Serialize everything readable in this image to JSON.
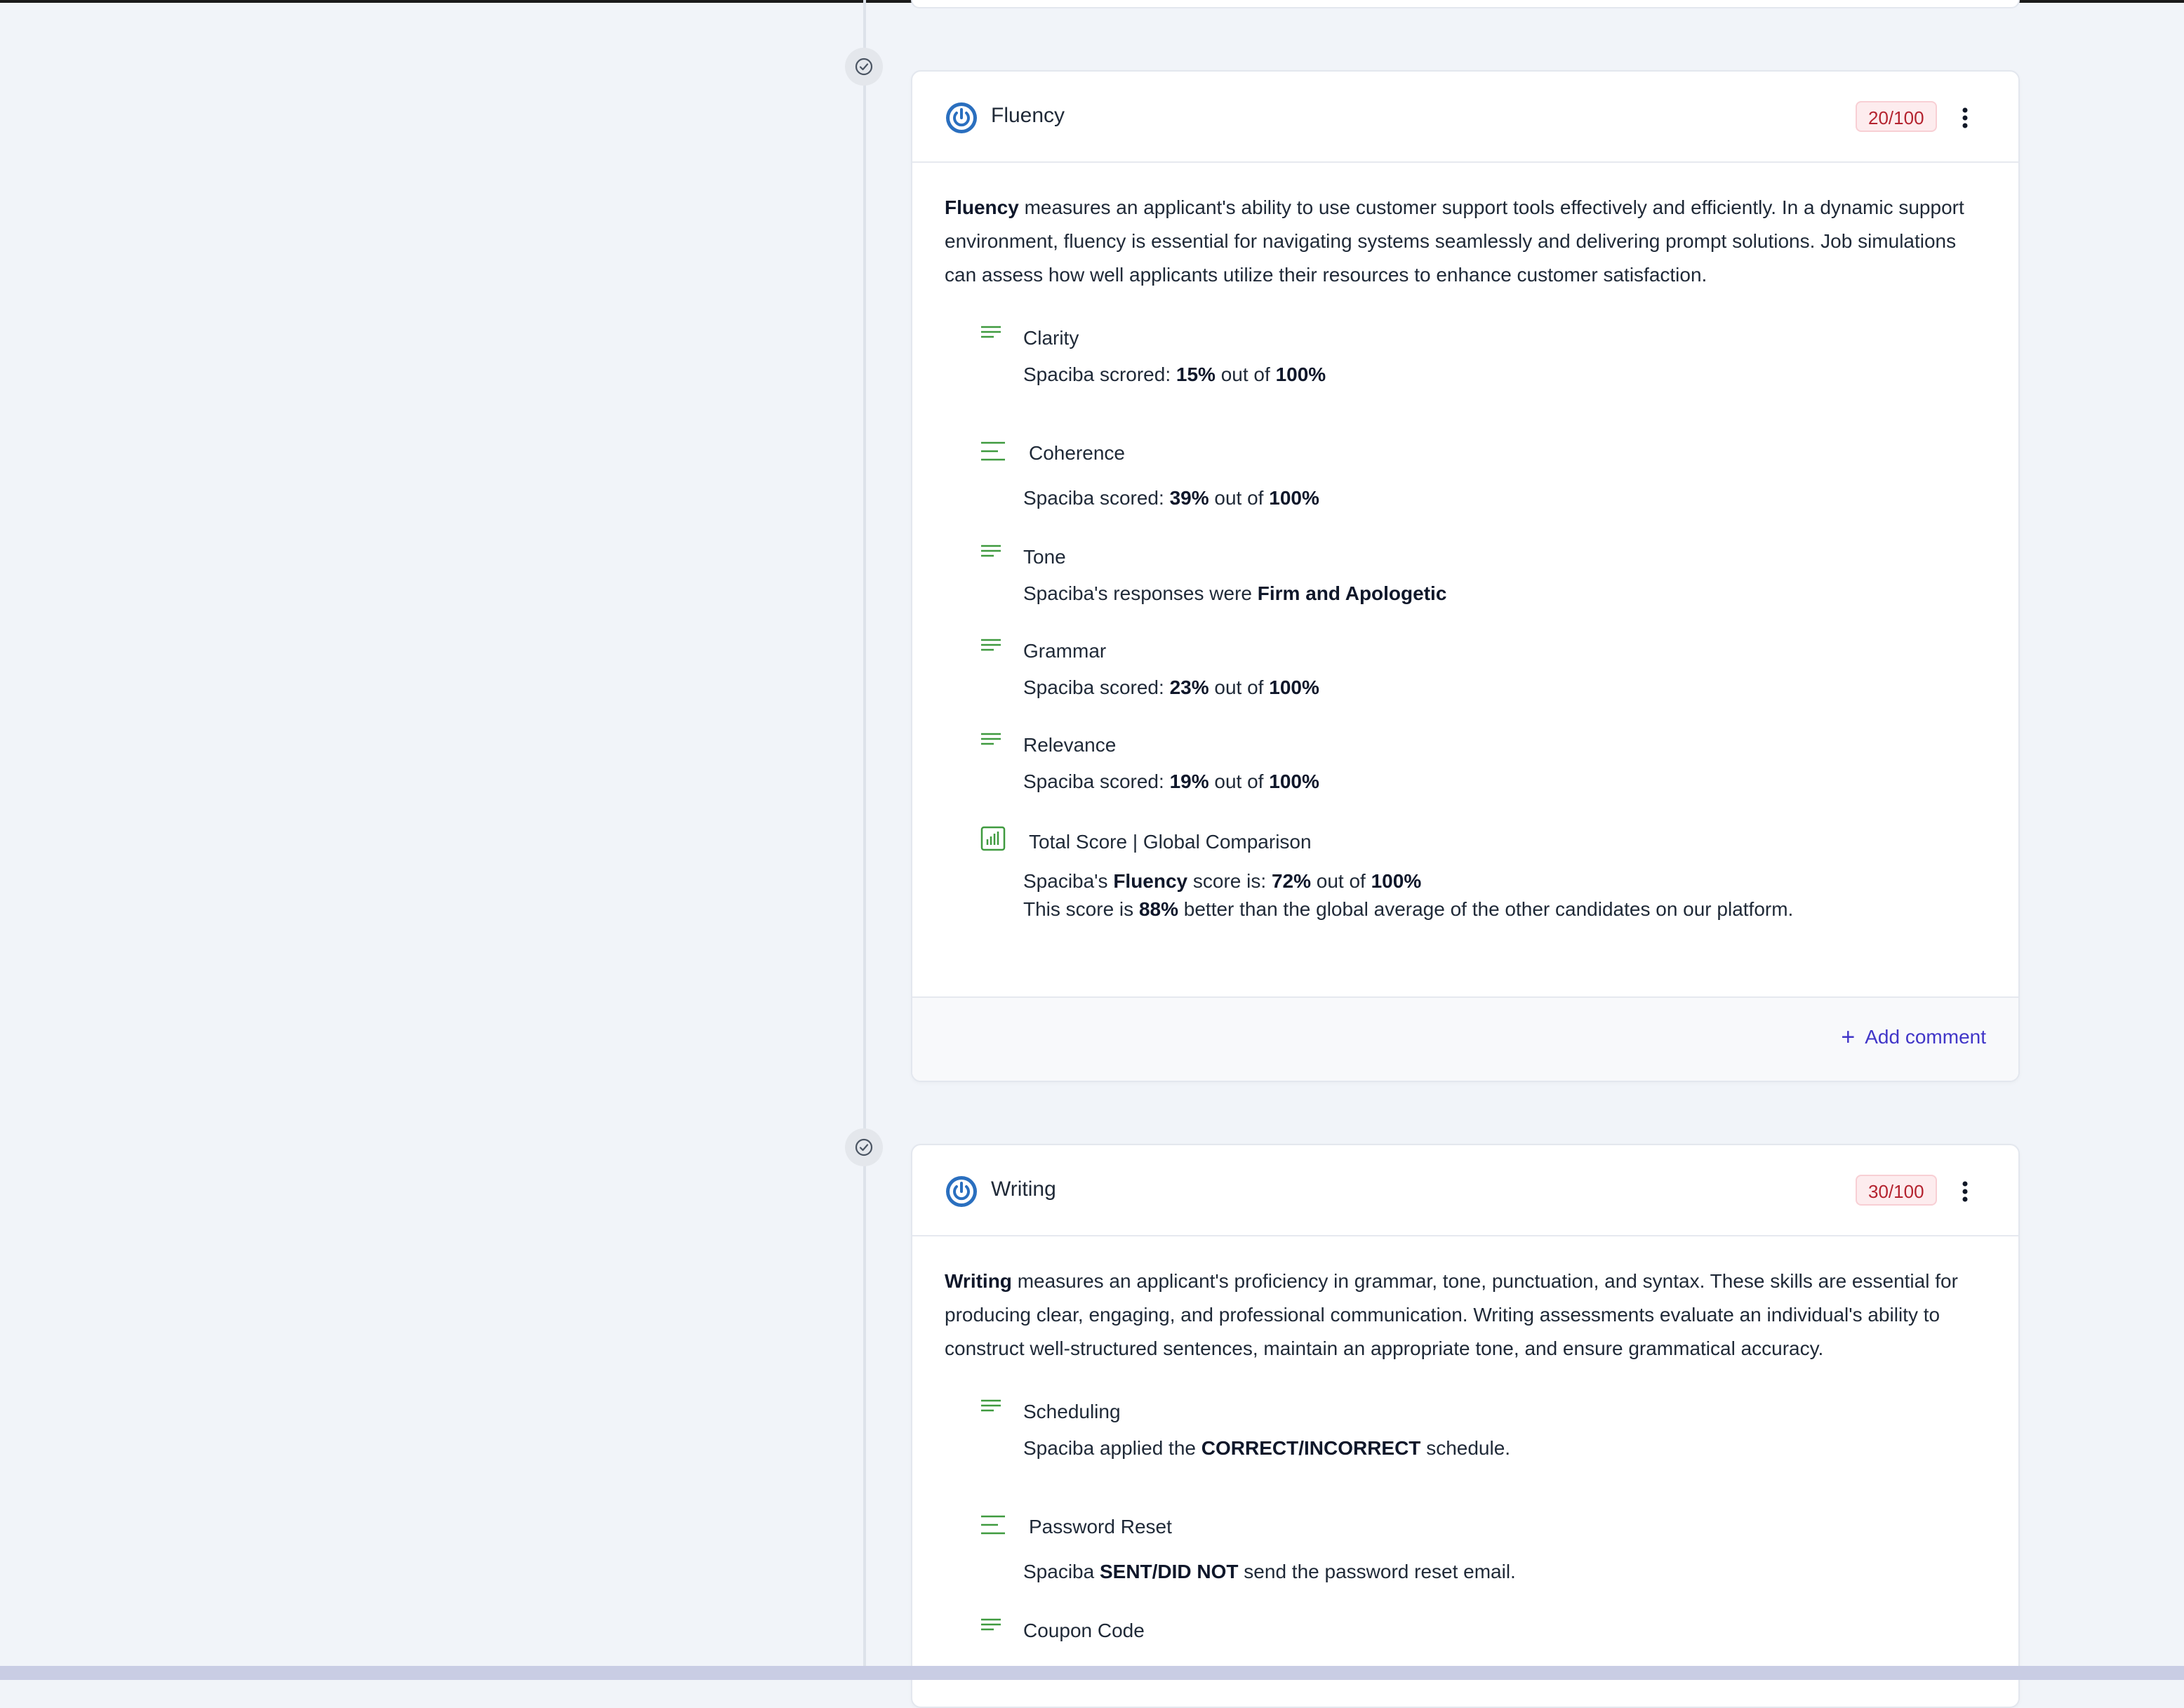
{
  "colors": {
    "accent_blue": "#2a6fbf",
    "green_icon": "#3f9a3f",
    "badge_bg": "#fdecee",
    "badge_text": "#b4232f",
    "link": "#4136c8"
  },
  "fluency": {
    "title": "Fluency",
    "score_badge": "20/100",
    "intro_bold": "Fluency",
    "intro_rest": " measures an applicant's ability to use customer support tools effectively and efficiently. In a dynamic support environment, fluency is essential for navigating systems seamlessly and delivering prompt solutions. Job simulations can assess how well applicants utilize their resources to enhance customer satisfaction.",
    "items": [
      {
        "title": "Clarity",
        "pre": "Spaciba scrored: ",
        "value": "15%",
        "mid": " out of ",
        "max": "100%"
      },
      {
        "title": "Coherence",
        "pre": "Spaciba scored: ",
        "value": "39%",
        "mid": " out of ",
        "max": "100%"
      },
      {
        "title": "Tone",
        "pre": "Spaciba's responses were ",
        "value": "Firm and Apologetic"
      },
      {
        "title": "Grammar",
        "pre": "Spaciba scored: ",
        "value": "23%",
        "mid": " out of ",
        "max": "100%"
      },
      {
        "title": "Relevance",
        "pre": "Spaciba scored: ",
        "value": "19%",
        "mid": " out of ",
        "max": "100%"
      }
    ],
    "total": {
      "title": "Total Score | Global Comparison",
      "line1_pre": "Spaciba's ",
      "line1_bold": "Fluency",
      "line1_mid": " score is: ",
      "line1_value": "72%",
      "line1_mid2": " out of ",
      "line1_max": "100%",
      "line2_pre": "This score is ",
      "line2_value": "88%",
      "line2_rest": " better than the global average of the other candidates on our platform."
    },
    "add_comment": "Add comment"
  },
  "writing": {
    "title": "Writing",
    "score_badge": "30/100",
    "intro_bold": "Writing",
    "intro_rest": " measures an applicant's proficiency in grammar, tone, punctuation, and syntax. These skills are essential for producing clear, engaging, and professional communication. Writing assessments evaluate an individual's ability to construct well-structured sentences, maintain an appropriate tone, and ensure grammatical accuracy.",
    "items": [
      {
        "title": "Scheduling",
        "pre": "Spaciba applied the ",
        "value": "CORRECT/INCORRECT",
        "post": " schedule."
      },
      {
        "title": "Password Reset",
        "pre": "Spaciba ",
        "value": "SENT/DID NOT",
        "post": " send the password reset email."
      },
      {
        "title": "Coupon Code"
      }
    ]
  }
}
